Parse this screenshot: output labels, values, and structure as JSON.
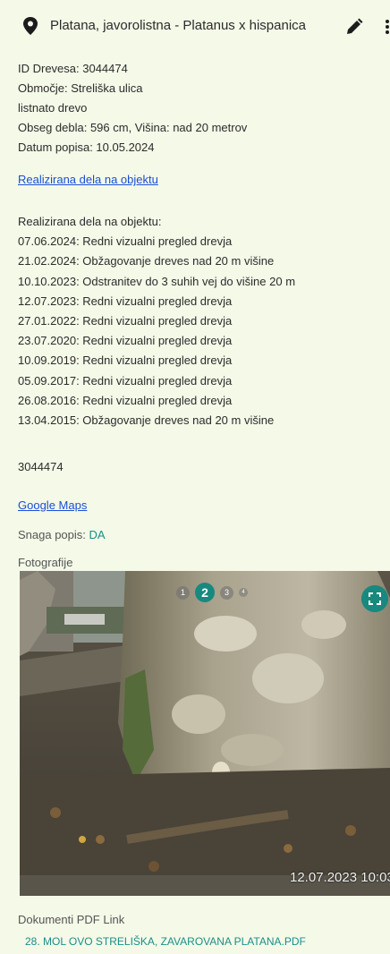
{
  "header": {
    "title": "Platana, javorolistna - Platanus x hispanica"
  },
  "info": {
    "id": "ID Drevesa: 3044474",
    "area": "Območje: Streliška ulica",
    "type": "listnato drevo",
    "size": "Obseg debla: 596 cm, Višina: nad 20 metrov",
    "date": "Datum popisa: 10.05.2024"
  },
  "work_link": "Realizirana dela na objektu",
  "works": {
    "heading": "Realizirana dela na objektu:",
    "items": [
      "07.06.2024: Redni vizualni pregled drevja",
      "21.02.2024: Obžagovanje dreves nad 20 m višine",
      "10.10.2023: Odstranitev do 3 suhih vej do višine 20 m",
      "12.07.2023: Redni vizualni pregled drevja",
      "27.01.2022: Redni vizualni pregled drevja",
      "23.07.2020: Redni vizualni pregled drevja",
      "10.09.2019: Redni vizualni pregled drevja",
      "05.09.2017: Redni vizualni pregled drevja",
      "26.08.2016: Redni vizualni pregled drevja",
      "13.04.2015: Obžagovanje dreves nad 20 m višine"
    ]
  },
  "tree_id": "3044474",
  "google_maps": "Google Maps",
  "snaga": {
    "label": "Snaga popis: ",
    "value": "DA"
  },
  "photos": {
    "label": "Fotografije",
    "dots": [
      "1",
      "2",
      "3",
      "4"
    ],
    "active": "2",
    "timestamp": "12.07.2023 10:03"
  },
  "documents": {
    "label": "Dokumenti PDF Link",
    "link": "28. MOL OVO STRELIŠKA, ZAVAROVANA PLATANA.PDF"
  },
  "icons": {
    "pin": "map-pin-icon",
    "edit": "pencil-icon",
    "more": "more-vertical-icon",
    "fullscreen": "fullscreen-icon"
  },
  "colors": {
    "background": "#f4f9e8",
    "accent": "#17897f",
    "link": "#1a4fd6"
  }
}
